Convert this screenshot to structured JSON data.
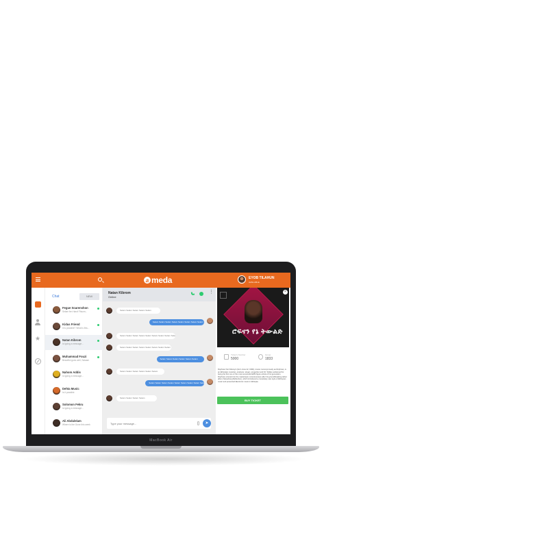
{
  "app": {
    "title": "meda",
    "logo_letter": "a"
  },
  "header": {
    "user_name": "EYOB TILAHUN",
    "user_status": "AVAILABLE"
  },
  "laptop": {
    "brand": "MacBook Air"
  },
  "chatlist": {
    "tab_chat": "Chat",
    "tab_new": "NEW",
    "contacts": [
      {
        "name": "Fegue Soarenshon",
        "preview": "Selam fen Harof Fitsum...",
        "time": "",
        "avatar_color": "#8a5a3c",
        "online": true
      },
      {
        "name": "Kidus Friend",
        "preview": "It is possible? What is this...",
        "time": "",
        "avatar_color": "#6b4a3a",
        "online": true
      },
      {
        "name": "Natan Kibrom",
        "preview": "is typing a message...",
        "time": "",
        "avatar_color": "#4a3328",
        "online": true
      },
      {
        "name": "Muhammad Fouzi",
        "preview": "Beautiful goes well, Salaam",
        "time": "",
        "avatar_color": "#7a5240",
        "online": true
      },
      {
        "name": "Nahom Addis",
        "preview": "is typing a message...",
        "time": "",
        "avatar_color": "#e0b020",
        "online": false
      },
      {
        "name": "Dehta Music",
        "preview": "Is it possible",
        "time": "",
        "avatar_color": "#d66a2a",
        "online": false
      },
      {
        "name": "Solomon Fekru",
        "preview": "is typing a message...",
        "time": "",
        "avatar_color": "#5d4034",
        "online": false
      },
      {
        "name": "Ali Abdulelam",
        "preview": "Where is the Gone this week",
        "time": "",
        "avatar_color": "#3e2e26",
        "online": false
      }
    ]
  },
  "conversation": {
    "name": "Natan Kibrom",
    "status": "Online",
    "messages": [
      {
        "dir": "in",
        "text": "Selam Selam Selam Selam Selam"
      },
      {
        "dir": "out",
        "text": "Selam Selam Selam Selam Selam Selam Selam Selam"
      },
      {
        "dir": "in",
        "text": "Selam Selam Selam Selam Selam Selam Selam Selam Selam"
      },
      {
        "dir": "in",
        "text": "Selam Selam Selam Selam Selam Selam Selam Selam"
      },
      {
        "dir": "out",
        "text": "Selam Selam Selam Selam Selam Selam"
      },
      {
        "dir": "in",
        "text": "Selam Selam Selam Selam Selam Selam"
      },
      {
        "dir": "out",
        "text": "Selam Selam Selam Selam Selam Selam Selam Selam Selam"
      },
      {
        "dir": "in",
        "text": "Selam Selam Selam Selam"
      }
    ],
    "compose_placeholder": "Type your message..."
  },
  "event": {
    "poster_title": "ሮፍናን የኔ ትውልድ",
    "ticket_label": "Ticket's Number",
    "ticket_value": "5000",
    "group_label": "Group",
    "group_value": "1833",
    "bio": "Rophnan Nuri Muzeyin (born June 22, 1990), known mononymously as Rophnan, is an Ethiopian musician, producer, singer, songwriter and DJ. Widely acclaimed for being the first one of the most successful EDM figure artists of his generation. Rophnan entered into the mainstream consciousness after his groundbreaking debut album Netsebraq (Reflection), which introduced a completely new style of Ethiopian music and presented Electronic music in Ethiopia.",
    "buy_label": "BUY TICKET"
  }
}
